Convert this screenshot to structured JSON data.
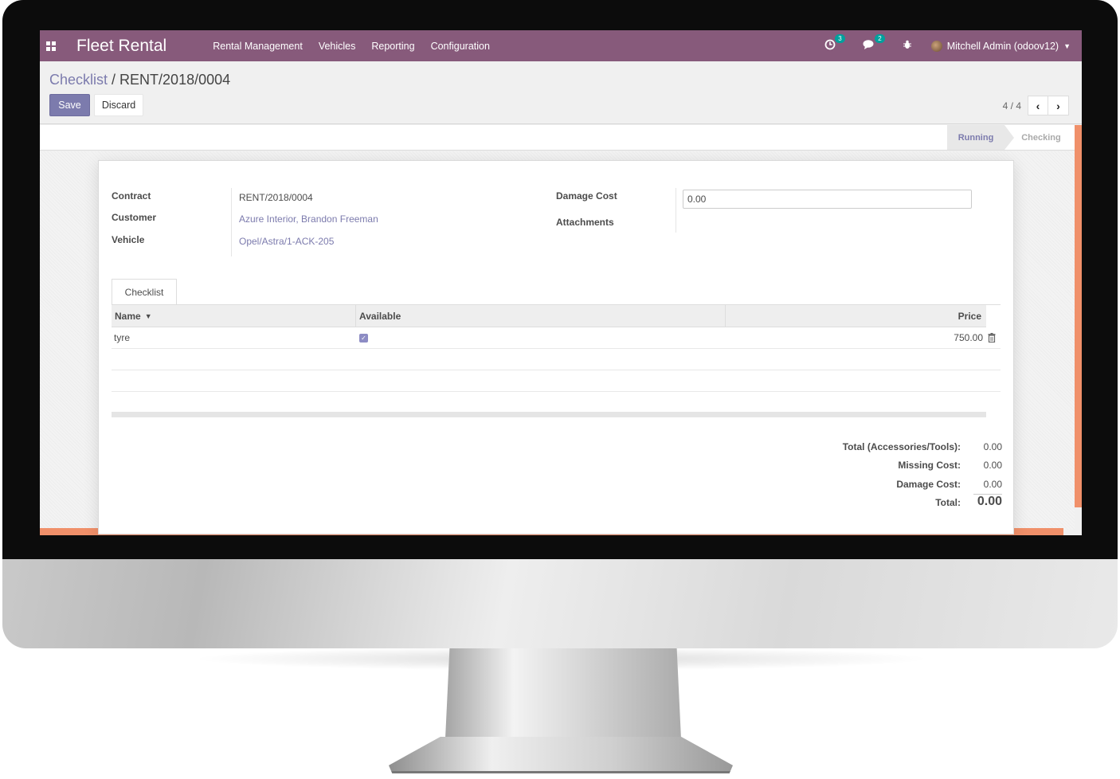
{
  "navbar": {
    "app_title": "Fleet Rental",
    "menu": [
      "Rental Management",
      "Vehicles",
      "Reporting",
      "Configuration"
    ],
    "activity_count": "3",
    "message_count": "2",
    "user_name": "Mitchell Admin (odoov12)",
    "color": "#875a7b"
  },
  "breadcrumb": {
    "parent": "Checklist",
    "separator": " / ",
    "current": "RENT/2018/0004"
  },
  "buttons": {
    "save": "Save",
    "discard": "Discard"
  },
  "pager": {
    "value": "4 / 4"
  },
  "status": {
    "stages": [
      "Running",
      "Checking"
    ],
    "active": "Running"
  },
  "form": {
    "contract_label": "Contract",
    "contract_value": "RENT/2018/0004",
    "customer_label": "Customer",
    "customer_value": "Azure Interior, Brandon Freeman",
    "vehicle_label": "Vehicle",
    "vehicle_value": "Opel/Astra/1-ACK-205",
    "damage_cost_label": "Damage Cost",
    "damage_cost_value": "0.00",
    "attachments_label": "Attachments"
  },
  "notebook": {
    "tab": "Checklist"
  },
  "table": {
    "headers": {
      "name": "Name",
      "available": "Available",
      "price": "Price"
    },
    "rows": [
      {
        "name": "tyre",
        "available": true,
        "price": "750.00"
      }
    ]
  },
  "totals": {
    "accessories_label": "Total (Accessories/Tools):",
    "accessories_value": "0.00",
    "missing_label": "Missing Cost:",
    "missing_value": "0.00",
    "damage_label": "Damage Cost:",
    "damage_value": "0.00",
    "total_label": "Total:",
    "total_value": "0.00"
  },
  "colors": {
    "accent": "#7c7bad",
    "highlight": "#f0906a"
  }
}
